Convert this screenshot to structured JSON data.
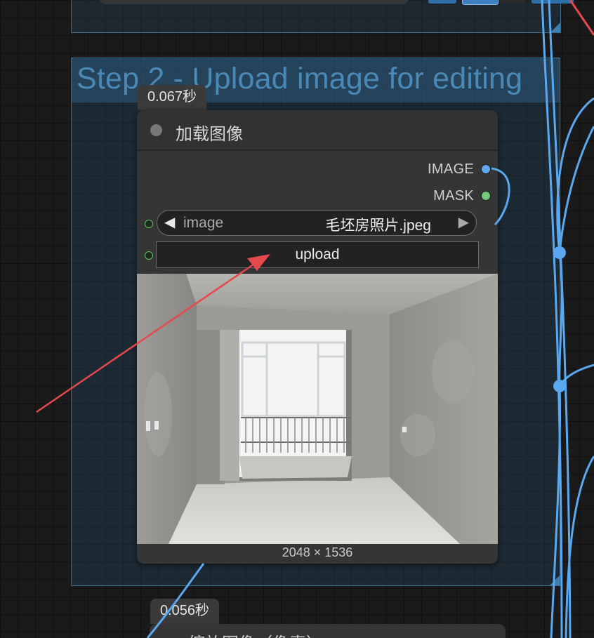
{
  "groups": {
    "step2": {
      "title": "Step 2 - Upload image for editing"
    }
  },
  "node_load_image": {
    "exec_time": "0.067秒",
    "title": "加载图像",
    "outputs": [
      {
        "label": "IMAGE",
        "color": "#63a7ec"
      },
      {
        "label": "MASK",
        "color": "#72c77a"
      }
    ],
    "image_widget": {
      "label": "image",
      "value": "毛坯房照片.jpeg",
      "prev_glyph": "◀",
      "next_glyph": "▶"
    },
    "upload_label": "upload",
    "image_size": "2048 × 1536"
  },
  "node_next": {
    "exec_time": "0.056秒",
    "title": "缩放图像（像素）"
  },
  "colors": {
    "group_title": "#4a88b6",
    "wire_image": "#5aa9f0",
    "annotation_arrow": "#e5484d"
  },
  "icons": {
    "prev": "triangle-left-icon",
    "next": "triangle-right-icon"
  }
}
